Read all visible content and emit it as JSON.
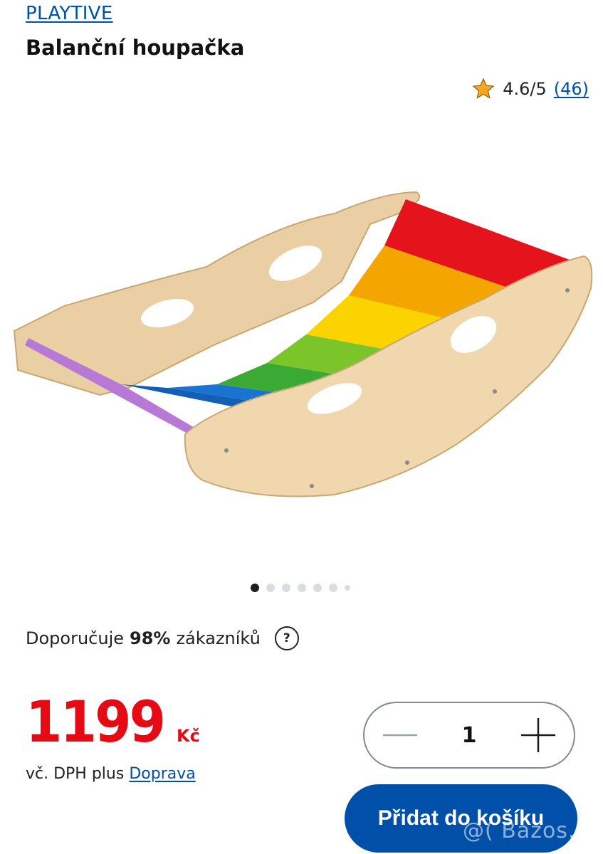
{
  "product": {
    "brand": "PLAYTIVE",
    "title": "Balanční houpačka",
    "rating": "4.6/5",
    "rating_count": "(46)"
  },
  "gallery": {
    "total_images": 7,
    "active_index": 0
  },
  "recommend": {
    "prefix": "Doporučuje",
    "percent": "98%",
    "suffix": "zákazníků",
    "help_icon": "?"
  },
  "price": {
    "amount": "1199",
    "currency": "Kč",
    "vat_text": "vč. DPH plus",
    "shipping_link": "Doprava"
  },
  "quantity": {
    "value": "1"
  },
  "cart": {
    "add_label": "Přidat do košíku"
  },
  "watermark": "@( Bazos.cz",
  "colors": {
    "brand_blue": "#0050aa",
    "price_red": "#e60a14",
    "star": "#f5a623"
  }
}
